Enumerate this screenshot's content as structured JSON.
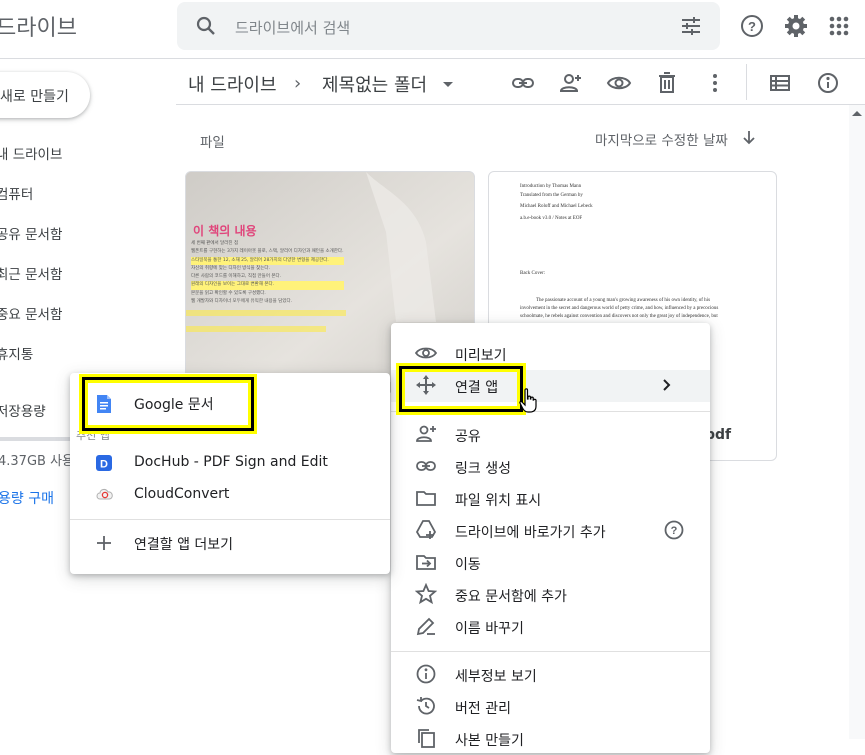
{
  "header": {
    "app_title": "드라이브",
    "search_placeholder": "드라이브에서 검색",
    "icons": [
      "search-icon",
      "tune-icon",
      "help-icon",
      "settings-icon",
      "apps-grid-icon"
    ]
  },
  "sidebar": {
    "new_button": "새로 만들기",
    "items": [
      "내 드라이브",
      "컴퓨터",
      "공유 문서함",
      "최근 문서함",
      "중요 문서함",
      "휴지통",
      "저장용량"
    ],
    "quota_text": "4.37GB 사용",
    "buy_storage": "용량 구매"
  },
  "toolbar": {
    "breadcrumb_root": "내 드라이브",
    "breadcrumb_sep": "›",
    "breadcrumb_current": "제목없는 폴더",
    "icons": [
      "link-icon",
      "add-person-icon",
      "preview-eye-icon",
      "trash-icon",
      "more-vert-icon",
      "list-view-icon",
      "info-icon"
    ]
  },
  "content": {
    "files_label": "파일",
    "sort_label": "마지막으로 수정한 날짜",
    "thumb1": {
      "heading": "이 책의 내용",
      "lines": [
        "세 번째 판에서 달라진 점",
        "웹폰트를 구현하는 3가지 레이아웃 플로, 스택, 알리어 디자인과 패턴을 소개한다.",
        "스타일북을 통한 12, 소재 25, 알리어 28가지의 다양한 변형을 제공한다.",
        "자신의 취향에 맞는 디자인 방식을 찾는다.",
        "다른 사람의 코드를 이해하고, 직접 만들어 본다.",
        "원래의 디자인을 보이는 그대로 변환해 본다.",
        "본문을 읽고 확인할 수 있도록 구성했다.",
        "웹 개발자와 디자이너 모두에게 유익한 내용을 담았다."
      ]
    },
    "thumb2": {
      "lines": [
        "Introduction by Thomas Mann",
        "Translated from the German by",
        "Michael Roloff and Michael Lebeck",
        "a.b.e-book v3.0 / Notes at EOF",
        "Back Cover:",
        "The passionate account of a young man's growing awareness of his own identity, of his",
        "involvement in the secret and dangerous world of petty crime, and how, influenced by a precocious",
        "schoolmate, he rebels against convention and discovers not only the great joy of independence, but"
      ],
      "name_suffix": "pdf"
    }
  },
  "context_menu": {
    "items": [
      {
        "label": "미리보기",
        "icon": "eye-icon"
      },
      {
        "label": "연결 앱",
        "icon": "move-arrows-icon",
        "submenu": true
      },
      {
        "label": "공유",
        "icon": "add-person-icon"
      },
      {
        "label": "링크 생성",
        "icon": "link-icon"
      },
      {
        "label": "파일 위치 표시",
        "icon": "folder-icon"
      },
      {
        "label": "드라이브에 바로가기 추가",
        "icon": "add-shortcut-icon",
        "help": true
      },
      {
        "label": "이동",
        "icon": "move-to-folder-icon"
      },
      {
        "label": "중요 문서함에 추가",
        "icon": "star-icon"
      },
      {
        "label": "이름 바꾸기",
        "icon": "edit-pencil-icon"
      },
      {
        "label": "세부정보 보기",
        "icon": "info-icon"
      },
      {
        "label": "버전 관리",
        "icon": "history-icon"
      },
      {
        "label": "사본 만들기",
        "icon": "copy-icon"
      }
    ]
  },
  "open_with_submenu": {
    "primary": "Google 문서",
    "suggested_header": "추천 앱",
    "apps": [
      "DocHub - PDF Sign and Edit",
      "CloudConvert"
    ],
    "more_apps": "연결할 앱 더보기"
  },
  "colors": {
    "accent_blue": "#1a73e8",
    "highlight_yellow": "#ffff00",
    "docs_blue": "#4285f4"
  }
}
